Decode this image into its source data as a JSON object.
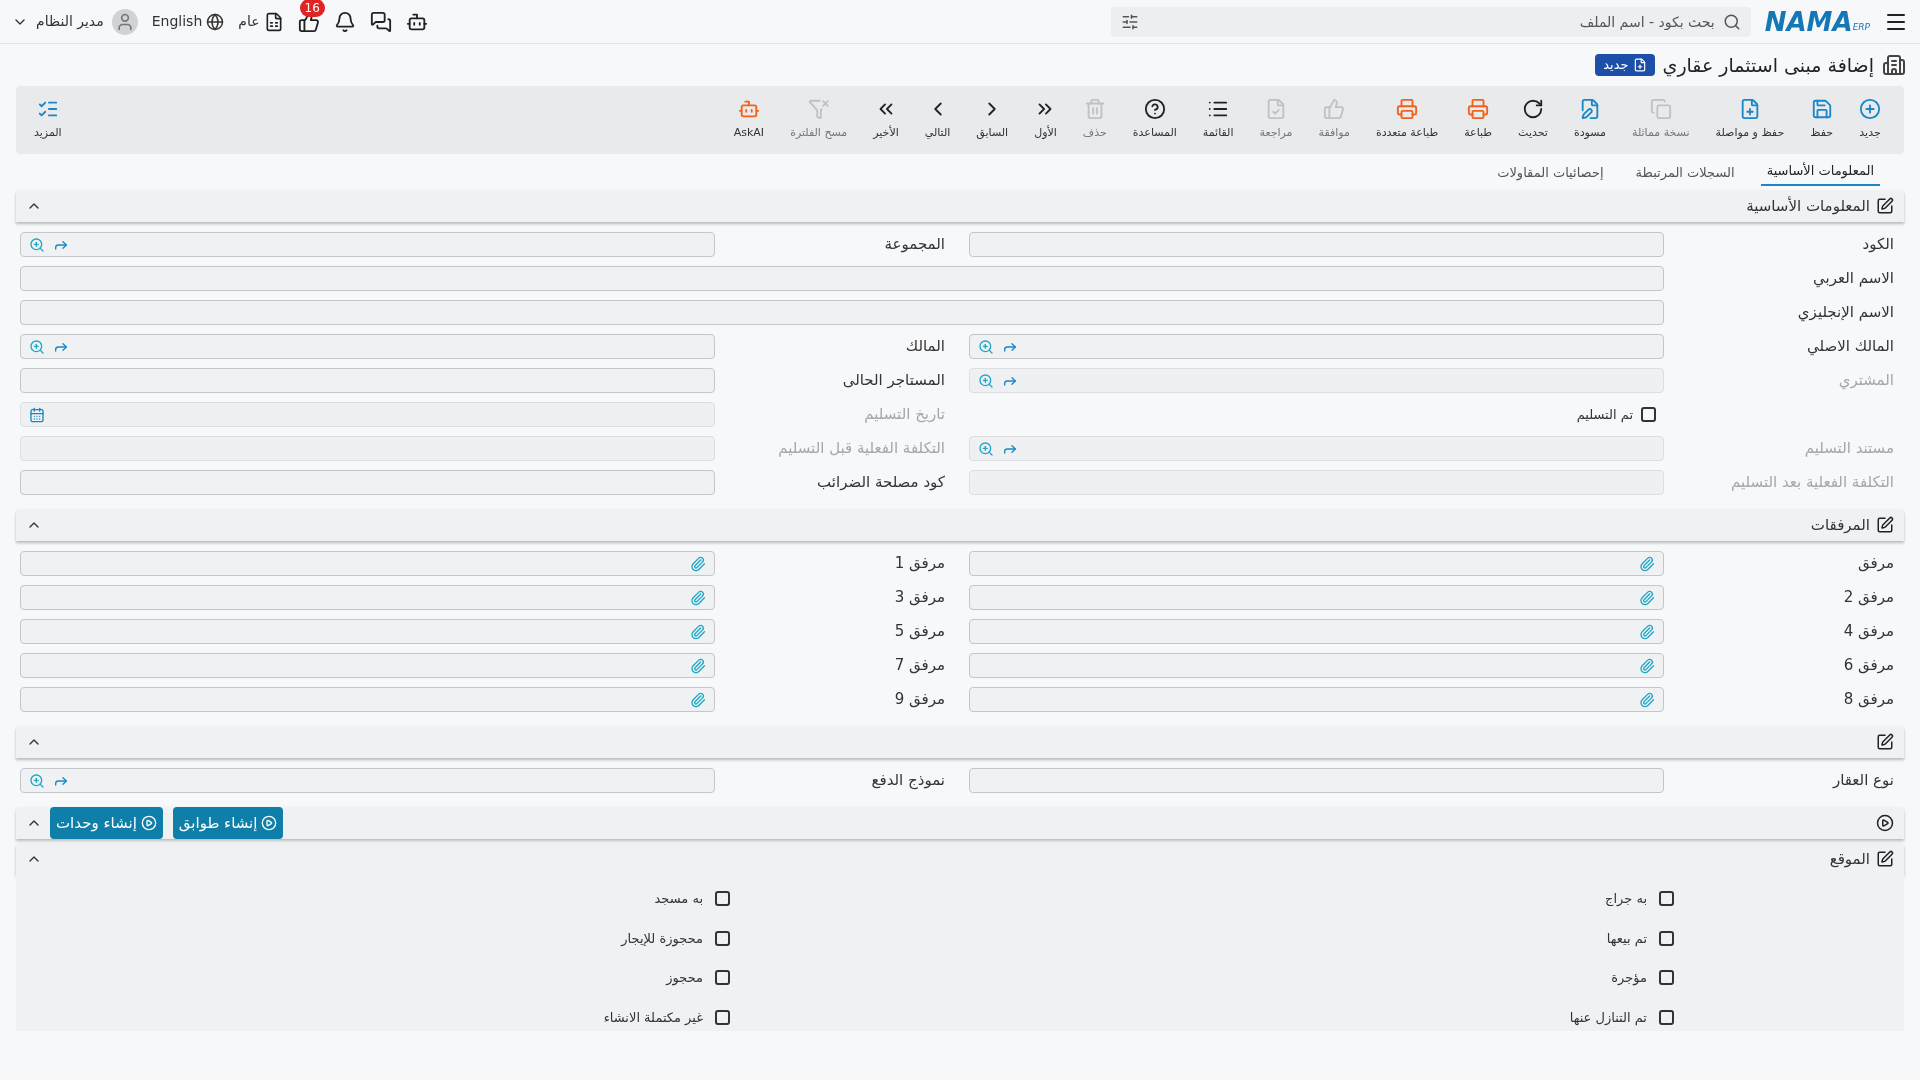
{
  "topbar": {
    "logo": "NAMA",
    "logo_sub": "ERP",
    "search": {
      "placeholder": "بحث بكود - اسم الملف"
    },
    "user": "مدير النظام",
    "language": "English",
    "branch": "عام",
    "notifications_badge": "16"
  },
  "page": {
    "title": "إضافة مبنى استثمار عقاري",
    "badge": "جديد"
  },
  "toolbar": [
    {
      "label": "جديد",
      "color": "#1a87c9",
      "disabled": false
    },
    {
      "label": "حفظ",
      "color": "#1a87c9",
      "disabled": false
    },
    {
      "label": "حفظ و مواصلة",
      "color": "#1a87c9",
      "disabled": false
    },
    {
      "label": "نسخة مماثلة",
      "disabled": true
    },
    {
      "label": "مسودة",
      "color": "#1a87c9",
      "disabled": false
    },
    {
      "label": "تحديث",
      "color": "#222222",
      "disabled": false
    },
    {
      "label": "طباعة",
      "color": "#f0621c",
      "disabled": false
    },
    {
      "label": "طباعة متعددة",
      "color": "#f0621c",
      "disabled": false
    },
    {
      "label": "موافقة",
      "disabled": true
    },
    {
      "label": "مراجعة",
      "disabled": true
    },
    {
      "label": "القائمة",
      "color": "#222222",
      "disabled": false
    },
    {
      "label": "المساعدة",
      "color": "#222222",
      "disabled": false
    },
    {
      "label": "حذف",
      "disabled": true
    },
    {
      "label": "الأول",
      "color": "#222222",
      "disabled": false
    },
    {
      "label": "السابق",
      "color": "#222222",
      "disabled": false
    },
    {
      "label": "التالي",
      "color": "#222222",
      "disabled": false
    },
    {
      "label": "الأخير",
      "color": "#222222",
      "disabled": false
    },
    {
      "label": "مسح الفلترة",
      "disabled": true
    },
    {
      "label": "AskAI",
      "color": "#f0621c",
      "disabled": false
    }
  ],
  "more": "المزيد",
  "tabs": [
    {
      "label": "المعلومات الأساسية",
      "selected": true
    },
    {
      "label": "السجلات المرتبطة",
      "selected": false
    },
    {
      "label": "إحصائيات المقاولات",
      "selected": false
    }
  ],
  "sections": [
    {
      "kind": "form",
      "title": "المعلومات الأساسية",
      "expanded": true,
      "fields": [
        {
          "label": "الكود",
          "kind": "text",
          "disabled": false,
          "wide": false
        },
        {
          "label": "المجموعة",
          "kind": "lookup",
          "disabled": false,
          "wide": false
        },
        {
          "label": "الاسم العربي",
          "kind": "text",
          "disabled": false,
          "wide": true
        },
        {
          "label": "الاسم الإنجليزي",
          "kind": "text",
          "disabled": false,
          "wide": true
        },
        {
          "label": "المالك الاصلي",
          "kind": "lookup",
          "disabled": false,
          "wide": false
        },
        {
          "label": "المالك",
          "kind": "lookup",
          "disabled": false,
          "wide": false
        },
        {
          "label": "المشتري",
          "kind": "lookup",
          "disabled": true,
          "wide": false
        },
        {
          "label": "المستاجر الحالى",
          "kind": "text",
          "disabled": false,
          "wide": false
        },
        {
          "label": "تم التسليم",
          "kind": "checkbox",
          "checked": false,
          "disabled": false,
          "wide": false
        },
        {
          "label": "تاريخ التسليم",
          "kind": "date",
          "disabled": true,
          "wide": false
        },
        {
          "label": "مستند التسليم",
          "kind": "lookup",
          "disabled": true,
          "wide": false
        },
        {
          "label": "التكلفة الفعلية قبل التسليم",
          "kind": "text",
          "disabled": true,
          "wide": false
        },
        {
          "label": "التكلفة الفعلية بعد التسليم",
          "kind": "text",
          "disabled": true,
          "wide": false
        },
        {
          "label": "كود مصلحة الضرائب",
          "kind": "text",
          "disabled": false,
          "wide": false
        }
      ]
    },
    {
      "kind": "form",
      "title": "المرفقات",
      "expanded": true,
      "fields": [
        {
          "label": "مرفق",
          "kind": "attachment",
          "disabled": false,
          "wide": false
        },
        {
          "label": "مرفق 1",
          "kind": "attachment",
          "disabled": false,
          "wide": false
        },
        {
          "label": "مرفق 2",
          "kind": "attachment",
          "disabled": false,
          "wide": false
        },
        {
          "label": "مرفق 3",
          "kind": "attachment",
          "disabled": false,
          "wide": false
        },
        {
          "label": "مرفق 4",
          "kind": "attachment",
          "disabled": false,
          "wide": false
        },
        {
          "label": "مرفق 5",
          "kind": "attachment",
          "disabled": false,
          "wide": false
        },
        {
          "label": "مرفق 6",
          "kind": "attachment",
          "disabled": false,
          "wide": false
        },
        {
          "label": "مرفق 7",
          "kind": "attachment",
          "disabled": false,
          "wide": false
        },
        {
          "label": "مرفق 8",
          "kind": "attachment",
          "disabled": false,
          "wide": false
        },
        {
          "label": "مرفق 9",
          "kind": "attachment",
          "disabled": false,
          "wide": false
        }
      ]
    },
    {
      "kind": "form",
      "expanded": true,
      "fields": [
        {
          "label": "نوع العقار",
          "kind": "text",
          "disabled": false,
          "wide": false
        },
        {
          "label": "نموذج الدفع",
          "kind": "lookup",
          "disabled": false,
          "wide": false
        }
      ]
    },
    {
      "kind": "actions",
      "expanded": true,
      "buttons": [
        "إنشاء طوابق",
        "إنشاء وحدات"
      ]
    },
    {
      "kind": "checks",
      "title": "الموقع",
      "expanded": true,
      "checks": [
        {
          "label": "به جراج",
          "checked": false
        },
        {
          "label": "به مسجد",
          "checked": false
        },
        {
          "label": "تم بيعها",
          "checked": false
        },
        {
          "label": "محجوزة للإيجار",
          "checked": false
        },
        {
          "label": "مؤجرة",
          "checked": false
        },
        {
          "label": "محجوز",
          "checked": false
        },
        {
          "label": "تم التنازل عنها",
          "checked": false
        },
        {
          "label": "غير مكتملة الانشاء",
          "checked": false
        }
      ]
    }
  ]
}
